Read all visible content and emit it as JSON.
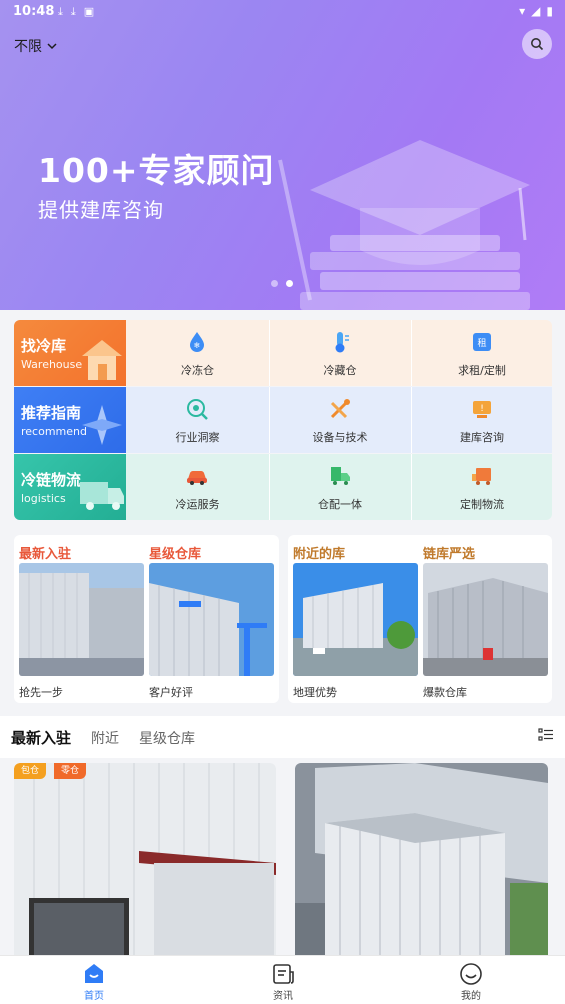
{
  "status_bar": {
    "time": "10:48"
  },
  "header": {
    "location": "不限"
  },
  "banner": {
    "title": "100+专家顾问",
    "subtitle": "提供建库咨询",
    "slide_count": 2,
    "active_slide": 2
  },
  "service_rows": [
    {
      "title": "找冷库",
      "en": "Warehouse",
      "color": "#f7873b",
      "cells": [
        {
          "label": "冷冻仓",
          "icon": "snowflake-drop-icon"
        },
        {
          "label": "冷藏仓",
          "icon": "thermometer-icon"
        },
        {
          "label": "求租/定制",
          "icon": "rent-icon"
        }
      ]
    },
    {
      "title": "推荐指南",
      "en": "recommend",
      "color": "#3d7bf4",
      "cells": [
        {
          "label": "行业洞察",
          "icon": "eye-insight-icon"
        },
        {
          "label": "设备与技术",
          "icon": "tools-icon"
        },
        {
          "label": "建库咨询",
          "icon": "consult-icon"
        }
      ]
    },
    {
      "title": "冷链物流",
      "en": "logistics",
      "color": "#30c1a6",
      "cells": [
        {
          "label": "冷运服务",
          "icon": "car-icon"
        },
        {
          "label": "仓配一体",
          "icon": "truck-icon"
        },
        {
          "label": "定制物流",
          "icon": "custom-truck-icon"
        }
      ]
    }
  ],
  "features": [
    {
      "title": "最新入驻",
      "desc": "抢先一步",
      "color": "#e8583a"
    },
    {
      "title": "星级仓库",
      "desc": "客户好评",
      "color": "#e8583a"
    },
    {
      "title": "附近的库",
      "desc": "地理优势",
      "color": "#c07a2c"
    },
    {
      "title": "链库严选",
      "desc": "爆款仓库",
      "color": "#c07a2c"
    }
  ],
  "tabs": [
    {
      "label": "最新入驻",
      "active": true
    },
    {
      "label": "附近"
    },
    {
      "label": "星级仓库"
    }
  ],
  "listing_tags": [
    "包仓",
    "零仓"
  ],
  "bottom_nav": [
    {
      "label": "首页",
      "icon": "home-icon",
      "active": true
    },
    {
      "label": "资讯",
      "icon": "news-icon"
    },
    {
      "label": "我的",
      "icon": "profile-icon"
    }
  ]
}
